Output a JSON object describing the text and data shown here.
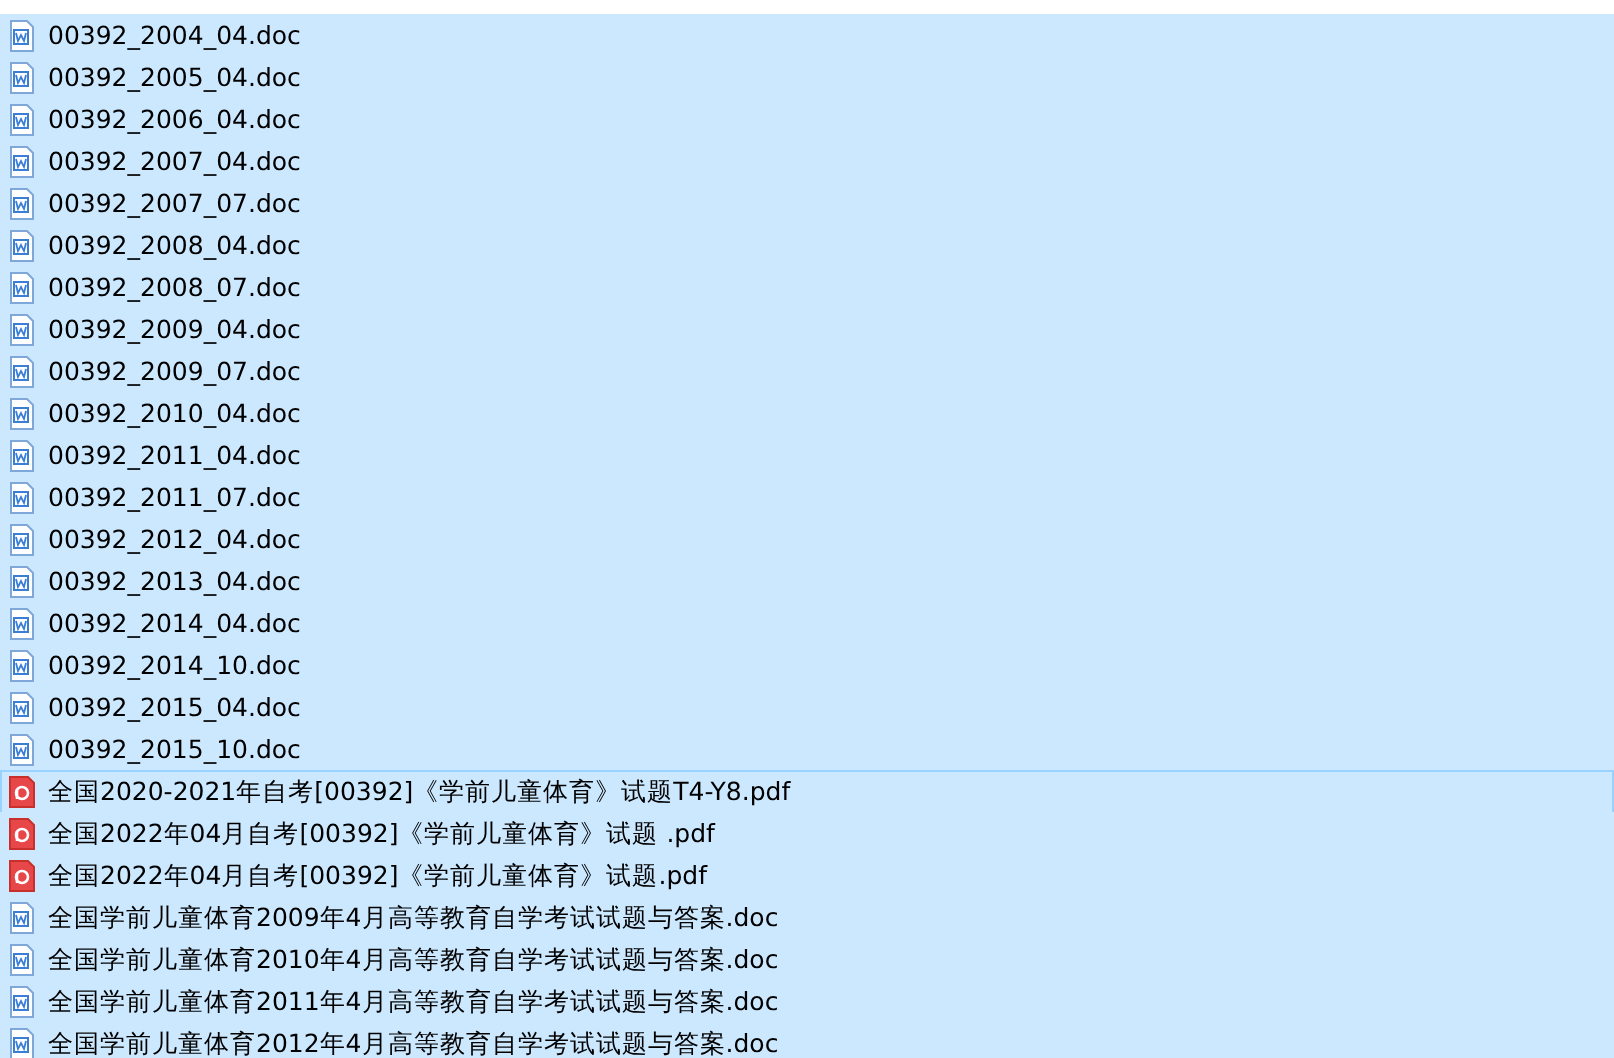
{
  "files": [
    {
      "name": "00392_2004_04.doc",
      "kind": "doc",
      "selected": true,
      "focused": false
    },
    {
      "name": "00392_2005_04.doc",
      "kind": "doc",
      "selected": true,
      "focused": false
    },
    {
      "name": "00392_2006_04.doc",
      "kind": "doc",
      "selected": true,
      "focused": false
    },
    {
      "name": "00392_2007_04.doc",
      "kind": "doc",
      "selected": true,
      "focused": false
    },
    {
      "name": "00392_2007_07.doc",
      "kind": "doc",
      "selected": true,
      "focused": false
    },
    {
      "name": "00392_2008_04.doc",
      "kind": "doc",
      "selected": true,
      "focused": false
    },
    {
      "name": "00392_2008_07.doc",
      "kind": "doc",
      "selected": true,
      "focused": false
    },
    {
      "name": "00392_2009_04.doc",
      "kind": "doc",
      "selected": true,
      "focused": false
    },
    {
      "name": "00392_2009_07.doc",
      "kind": "doc",
      "selected": true,
      "focused": false
    },
    {
      "name": "00392_2010_04.doc",
      "kind": "doc",
      "selected": true,
      "focused": false
    },
    {
      "name": "00392_2011_04.doc",
      "kind": "doc",
      "selected": true,
      "focused": false
    },
    {
      "name": "00392_2011_07.doc",
      "kind": "doc",
      "selected": true,
      "focused": false
    },
    {
      "name": "00392_2012_04.doc",
      "kind": "doc",
      "selected": true,
      "focused": false
    },
    {
      "name": "00392_2013_04.doc",
      "kind": "doc",
      "selected": true,
      "focused": false
    },
    {
      "name": "00392_2014_04.doc",
      "kind": "doc",
      "selected": true,
      "focused": false
    },
    {
      "name": "00392_2014_10.doc",
      "kind": "doc",
      "selected": true,
      "focused": false
    },
    {
      "name": "00392_2015_04.doc",
      "kind": "doc",
      "selected": true,
      "focused": false
    },
    {
      "name": "00392_2015_10.doc",
      "kind": "doc",
      "selected": true,
      "focused": false
    },
    {
      "name": "全国2020-2021年自考[00392]《学前儿童体育》试题T4-Y8.pdf",
      "kind": "pdf",
      "selected": true,
      "focused": true
    },
    {
      "name": "全国2022年04月自考[00392]《学前儿童体育》试题 .pdf",
      "kind": "pdf",
      "selected": true,
      "focused": false
    },
    {
      "name": "全国2022年04月自考[00392]《学前儿童体育》试题.pdf",
      "kind": "pdf",
      "selected": true,
      "focused": false
    },
    {
      "name": "全国学前儿童体育2009年4月高等教育自学考试试题与答案.doc",
      "kind": "doc",
      "selected": true,
      "focused": false
    },
    {
      "name": "全国学前儿童体育2010年4月高等教育自学考试试题与答案.doc",
      "kind": "doc",
      "selected": true,
      "focused": false
    },
    {
      "name": "全国学前儿童体育2011年4月高等教育自学考试试题与答案.doc",
      "kind": "doc",
      "selected": true,
      "focused": false
    },
    {
      "name": "全国学前儿童体育2012年4月高等教育自学考试试题与答案.doc",
      "kind": "doc",
      "selected": true,
      "focused": false
    }
  ]
}
